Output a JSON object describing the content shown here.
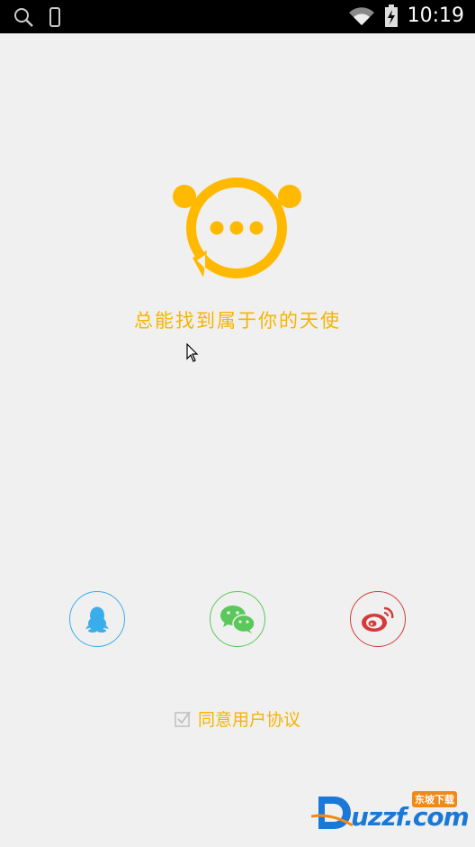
{
  "status_bar": {
    "time": "10:19",
    "icons": [
      "search-icon",
      "phone-icon",
      "wifi-icon",
      "battery-icon"
    ]
  },
  "brand": {
    "slogan": "总能找到属于你的天使",
    "accent_color": "#f6b400",
    "logo_icon": "chat-bubble-bear-icon"
  },
  "login": {
    "options": [
      {
        "icon": "qq-icon",
        "color": "#3aaeea"
      },
      {
        "icon": "wechat-icon",
        "color": "#5ac85a"
      },
      {
        "icon": "weibo-icon",
        "color": "#d43a3a"
      }
    ]
  },
  "agreement": {
    "checked": true,
    "label": "同意用户协议"
  },
  "watermark": {
    "text": "uzzf.com",
    "sub": "东坡下载"
  }
}
